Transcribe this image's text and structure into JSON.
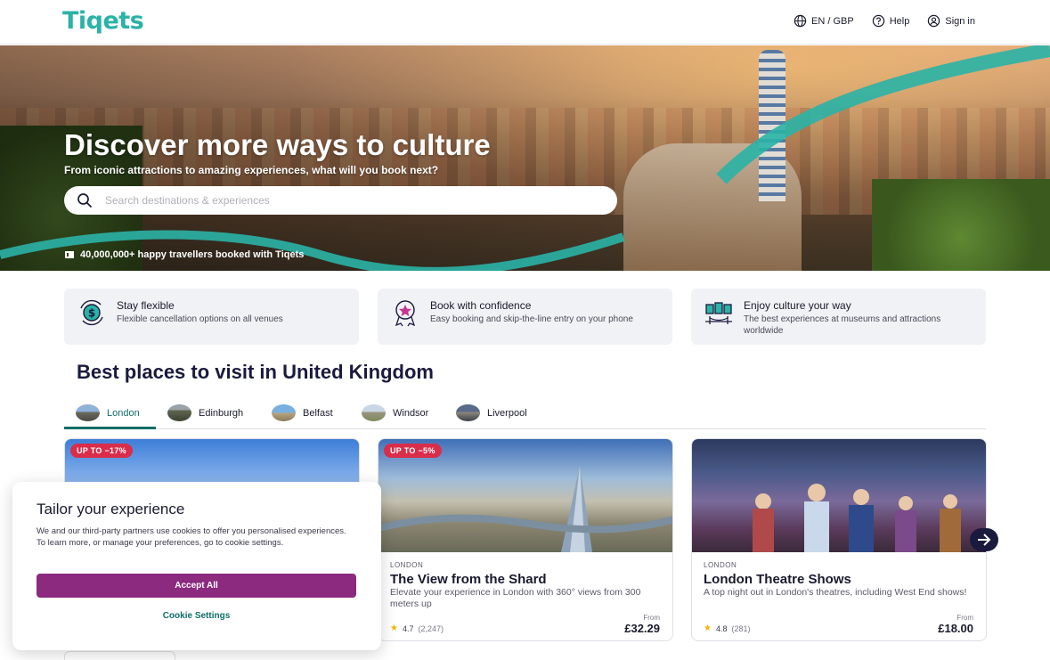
{
  "header": {
    "logo": "Tiqets",
    "nav": [
      {
        "label": "EN / GBP",
        "icon": "globe-icon"
      },
      {
        "label": "Help",
        "icon": "help-icon"
      },
      {
        "label": "Sign in",
        "icon": "user-icon"
      }
    ]
  },
  "hero": {
    "title": "Discover more ways to culture",
    "subtitle": "From iconic attractions to amazing experiences, what will you book next?",
    "search": {
      "placeholder": "Search destinations & experiences",
      "value": ""
    },
    "stat": "40,000,000+ happy travellers booked with Tiqets"
  },
  "features": [
    {
      "title": "Stay flexible",
      "desc": "Flexible cancellation options on all venues",
      "icon": "money-back-icon"
    },
    {
      "title": "Book with confidence",
      "desc": "Easy booking and skip-the-line entry on your phone",
      "icon": "ticket-star-icon"
    },
    {
      "title": "Enjoy culture your way",
      "desc": "The best experiences at museums and attractions worldwide",
      "icon": "museum-icon"
    }
  ],
  "section": {
    "title": "Best places to visit in United Kingdom",
    "tabs": [
      {
        "label": "London",
        "active": true
      },
      {
        "label": "Edinburgh",
        "active": false
      },
      {
        "label": "Belfast",
        "active": false
      },
      {
        "label": "Windsor",
        "active": false
      },
      {
        "label": "Liverpool",
        "active": false
      }
    ]
  },
  "cards": [
    {
      "badge": "UP TO −17%",
      "city": "",
      "title": "",
      "desc": "",
      "rating": "",
      "count": "",
      "from": "",
      "price": ""
    },
    {
      "badge": "UP TO −5%",
      "city": "LONDON",
      "title": "The View from the Shard",
      "desc": "Elevate your experience in London with 360° views from 300 meters up",
      "rating": "4.7",
      "count": "(2,247)",
      "from": "From",
      "price": "£32.29"
    },
    {
      "badge": "",
      "city": "LONDON",
      "title": "London Theatre Shows",
      "desc": "A top night out in London's theatres, including West End shows!",
      "rating": "4.8",
      "count": "(281)",
      "from": "From",
      "price": "£18.00"
    }
  ],
  "cookie": {
    "title": "Tailor your experience",
    "text": "We and our third-party partners use cookies to offer you personalised experiences. To learn more, or manage your preferences, go to cookie settings.",
    "accept": "Accept All",
    "settings": "Cookie Settings"
  },
  "colors": {
    "brand_teal": "#2ab3a6",
    "accent_dark_teal": "#0f6e68",
    "accept_purple": "#8b2a7f",
    "badge_red": "#d92d4a"
  }
}
